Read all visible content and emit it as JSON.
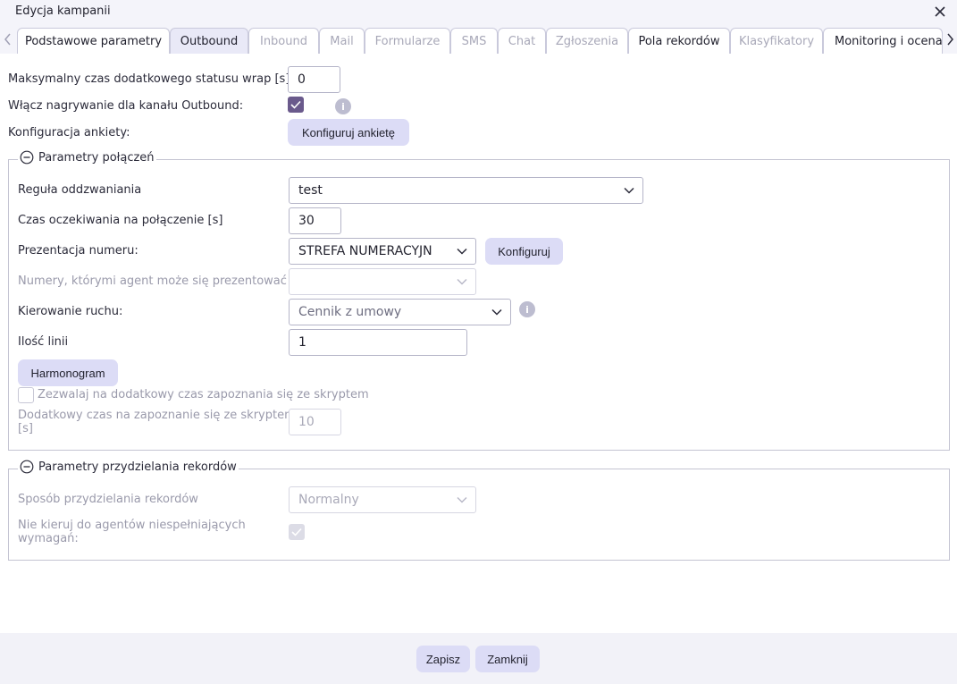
{
  "window": {
    "title": "Edycja kampanii",
    "close_icon": "close-icon"
  },
  "tabs": [
    {
      "label": "Podstawowe parametry",
      "state": "active"
    },
    {
      "label": "Outbound",
      "state": "highlight"
    },
    {
      "label": "Inbound",
      "state": "disabled"
    },
    {
      "label": "Mail",
      "state": "disabled"
    },
    {
      "label": "Formularze",
      "state": "disabled"
    },
    {
      "label": "SMS",
      "state": "disabled"
    },
    {
      "label": "Chat",
      "state": "disabled"
    },
    {
      "label": "Zgłoszenia",
      "state": "disabled"
    },
    {
      "label": "Pola rekordów",
      "state": "enabled"
    },
    {
      "label": "Klasyfikatory",
      "state": "disabled"
    },
    {
      "label": "Monitoring i ocena",
      "state": "enabled"
    }
  ],
  "general": {
    "wrap_label": "Maksymalny czas dodatkowego statusu wrap [s]",
    "wrap_value": "0",
    "recording_label": "Włącz nagrywanie dla kanału Outbound:",
    "recording_checked": true,
    "survey_label": "Konfiguracja ankiety:",
    "survey_button": "Konfiguruj ankietę"
  },
  "connections": {
    "legend": "Parametry połączeń",
    "callback_rule_label": "Reguła oddzwaniania",
    "callback_rule_value": "test",
    "wait_time_label": "Czas oczekiwania na połączenie [s]",
    "wait_time_value": "30",
    "number_presentation_label": "Prezentacja numeru:",
    "number_presentation_value": "STREFA NUMERACYJN",
    "configure_button": "Konfiguruj",
    "agent_numbers_label": "Numery, którymi agent może się prezentować",
    "agent_numbers_value": "",
    "traffic_label": "Kierowanie ruchu:",
    "traffic_value": "Cennik z umowy",
    "lines_label": "Ilość linii",
    "lines_value": "1",
    "schedule_button": "Harmonogram",
    "script_time_checkbox_label": "Zezwalaj na dodatkowy czas zapoznania się ze skryptem",
    "script_time_label_line1": "Dodatkowy czas na zapoznanie się ze skryptem",
    "script_time_label_line2": "[s]",
    "script_time_value": "10"
  },
  "records": {
    "legend": "Parametry przydzielania rekordów",
    "assign_method_label": "Sposób przydzielania rekordów",
    "assign_method_value": "Normalny",
    "no_route_label_line1": "Nie kieruj do agentów niespełniających",
    "no_route_label_line2": "wymagań:",
    "no_route_checked": true
  },
  "footer": {
    "save_button": "Zapisz",
    "close_button": "Zamknij"
  },
  "colors": {
    "accent": "#dcdcf6",
    "checkbox": "#6a5a8c",
    "border": "#b5b5c8"
  }
}
